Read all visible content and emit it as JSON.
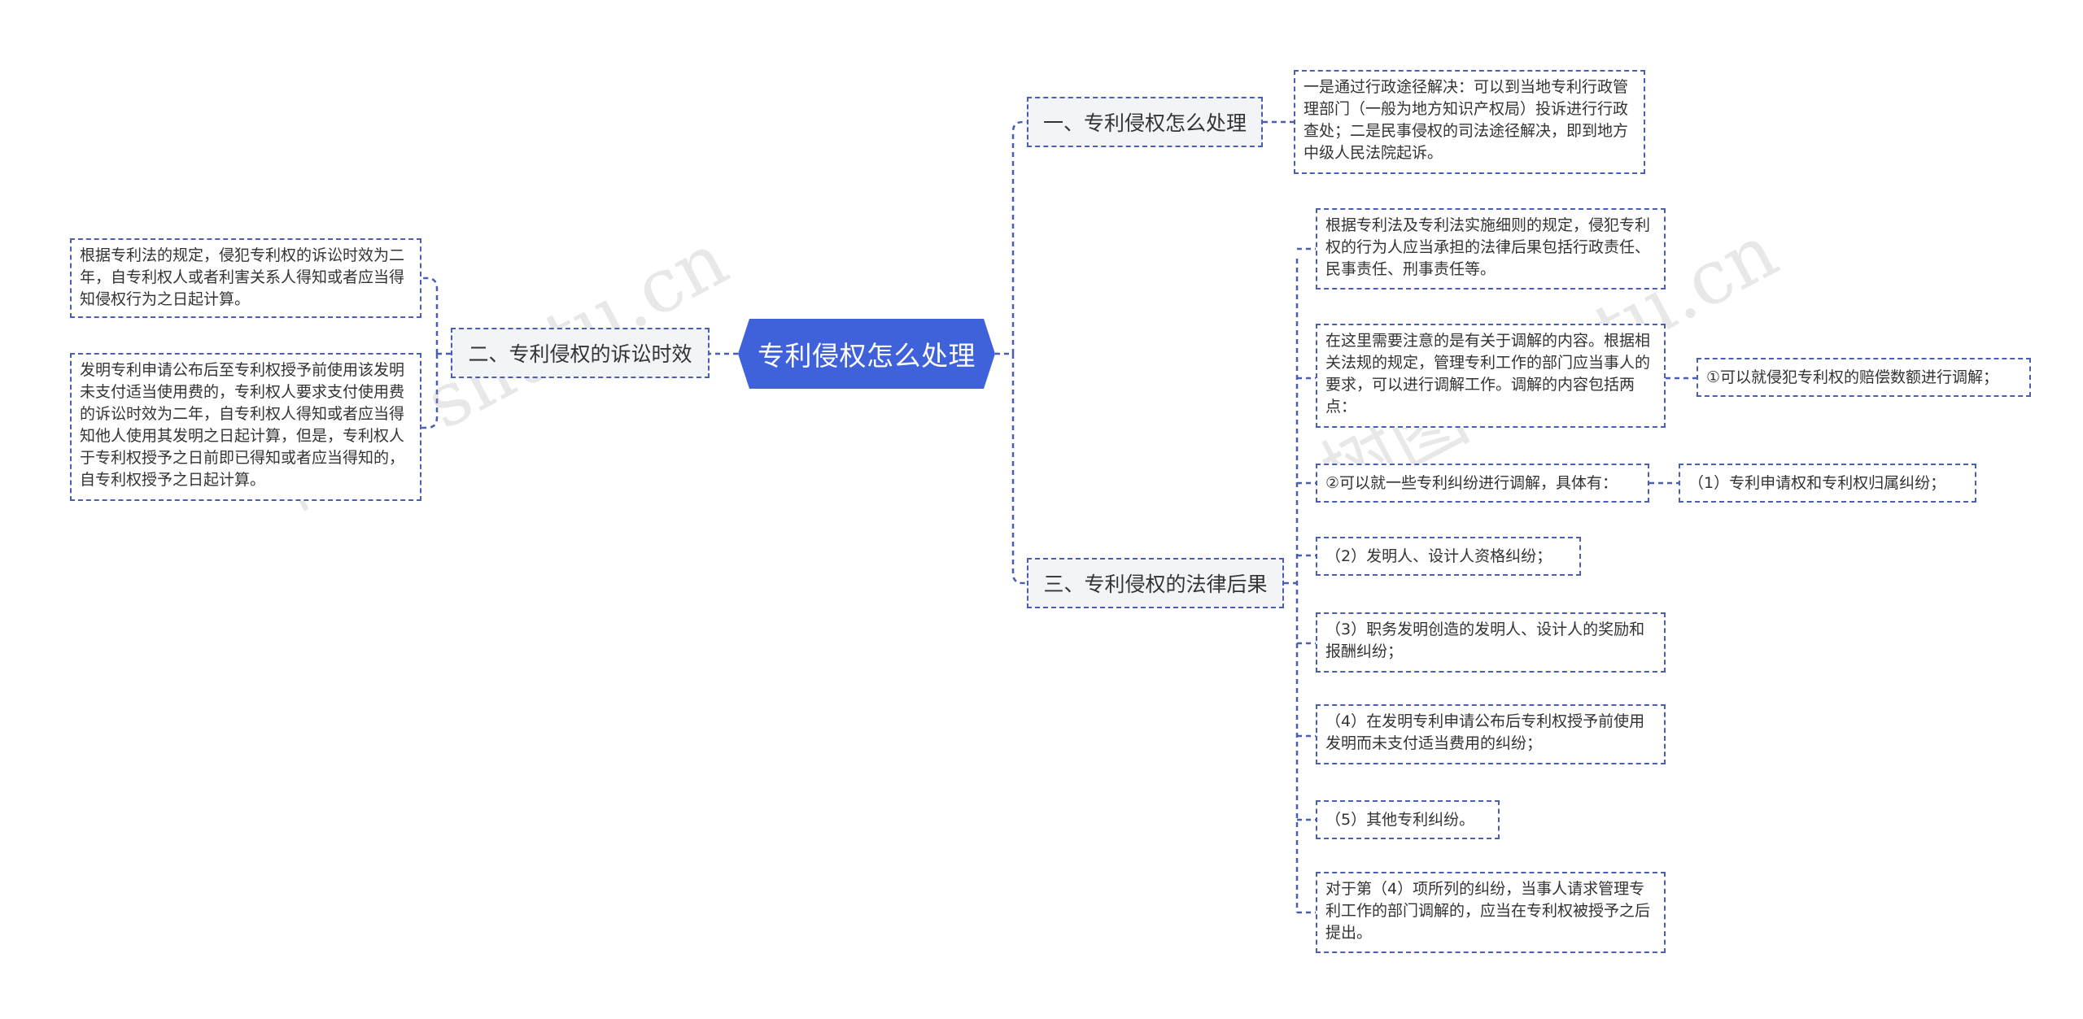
{
  "root": {
    "label": "专利侵权怎么处理"
  },
  "branches": [
    {
      "id": "b1",
      "label": "一、专利侵权怎么处理"
    },
    {
      "id": "b2",
      "label": "二、专利侵权的诉讼时效"
    },
    {
      "id": "b3",
      "label": "三、专利侵权的法律后果"
    }
  ],
  "b1_children": [
    "一是通过行政途径解决：可以到当地专利行政管理部门（一般为地方知识产权局）投诉进行行政查处；二是民事侵权的司法途径解决，即到地方中级人民法院起诉。"
  ],
  "b2_children": [
    "根据专利法的规定，侵犯专利权的诉讼时效为二年，自专利权人或者利害关系人得知或者应当得知侵权行为之日起计算。",
    "发明专利申请公布后至专利权授予前使用该发明未支付适当使用费的，专利权人要求支付使用费的诉讼时效为二年，自专利权人得知或者应当得知他人使用其发明之日起计算，但是，专利权人于专利权授予之日前即已得知或者应当得知的，自专利权授予之日起计算。"
  ],
  "b3_children": [
    "根据专利法及专利法实施细则的规定，侵犯专利权的行为人应当承担的法律后果包括行政责任、民事责任、刑事责任等。",
    "在这里需要注意的是有关于调解的内容。根据相关法规的规定，管理专利工作的部门应当事人的要求，可以进行调解工作。调解的内容包括两点：",
    "②可以就一些专利纠纷进行调解，具体有：",
    "（2）发明人、设计人资格纠纷；",
    "（3）职务发明创造的发明人、设计人的奖励和报酬纠纷；",
    "（4）在发明专利申请公布后专利权授予前使用发明而未支付适当费用的纠纷；",
    "（5）其他专利纠纷。",
    "对于第（4）项所列的纠纷，当事人请求管理专利工作的部门调解的，应当在专利权被授予之后提出。"
  ],
  "mediation_child": "①可以就侵犯专利权的赔偿数额进行调解；",
  "dispute_child": "（1）专利申请权和专利权归属纠纷；",
  "watermarks": [
    "树图 shutu.cn",
    "树图 shutu.cn"
  ],
  "colors": {
    "root_fill": "#3f61d9",
    "line": "#4a5fb3",
    "branch_fill": "#f3f4f8"
  }
}
